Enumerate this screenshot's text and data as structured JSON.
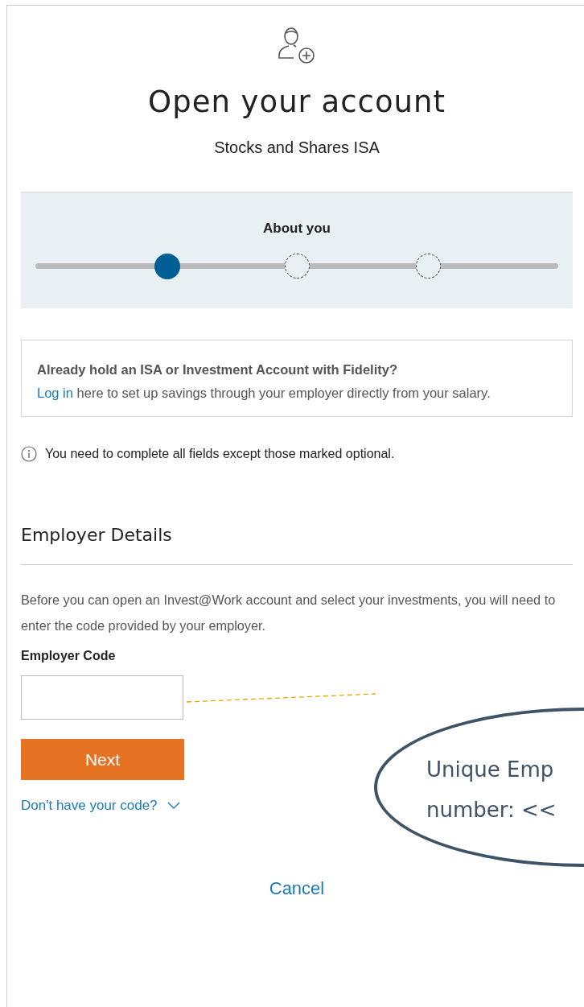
{
  "header": {
    "title": "Open your account",
    "subtitle": "Stocks and Shares ISA"
  },
  "progress": {
    "step_label": "About you",
    "steps": [
      {
        "selected": true
      },
      {
        "selected": false
      },
      {
        "selected": false
      }
    ]
  },
  "login_notice": {
    "heading": "Already hold an ISA or Investment Account with Fidelity?",
    "link": "Log in",
    "text": " here to set up savings through your employer directly from your salary."
  },
  "info_note": "You need to complete all fields except those marked optional.",
  "section": {
    "title": "Employer Details",
    "description": "Before you can open an Invest@Work account and select your investments, you will need to enter the code provided by your employer.",
    "field_label": "Employer Code",
    "next_button": "Next",
    "help_link": "Don't have your code?"
  },
  "cancel_link": "Cancel",
  "callout": {
    "lines": [
      "Unique Emp",
      "number: <<"
    ]
  }
}
